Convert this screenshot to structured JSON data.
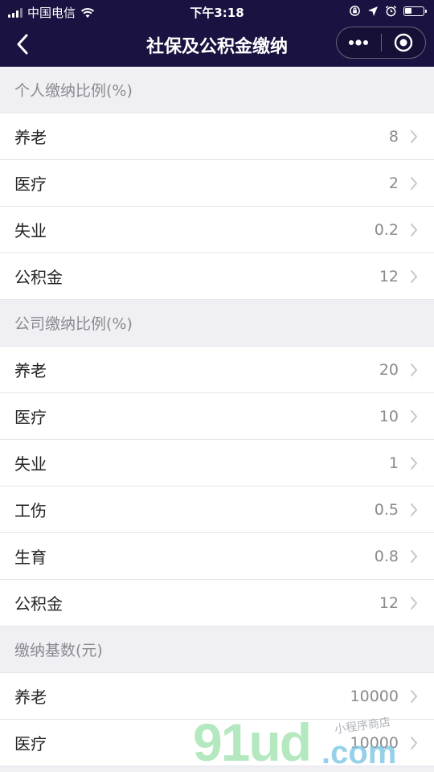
{
  "status_bar": {
    "carrier": "中国电信",
    "time": "下午3:18"
  },
  "nav": {
    "title": "社保及公积金缴纳",
    "back_icon": "chevron-left-icon",
    "more_icon": "more-dots-icon",
    "close_icon": "target-circle-icon"
  },
  "sections": [
    {
      "header": "个人缴纳比例(%)",
      "rows": [
        {
          "label": "养老",
          "value": "8"
        },
        {
          "label": "医疗",
          "value": "2"
        },
        {
          "label": "失业",
          "value": "0.2"
        },
        {
          "label": "公积金",
          "value": "12"
        }
      ]
    },
    {
      "header": "公司缴纳比例(%)",
      "rows": [
        {
          "label": "养老",
          "value": "20"
        },
        {
          "label": "医疗",
          "value": "10"
        },
        {
          "label": "失业",
          "value": "1"
        },
        {
          "label": "工伤",
          "value": "0.5"
        },
        {
          "label": "生育",
          "value": "0.8"
        },
        {
          "label": "公积金",
          "value": "12"
        }
      ]
    },
    {
      "header": "缴纳基数(元)",
      "rows": [
        {
          "label": "养老",
          "value": "10000"
        },
        {
          "label": "医疗",
          "value": "10000"
        }
      ]
    }
  ],
  "watermark": {
    "main": "91ud",
    "dot": ".com",
    "sub": "小程序商店"
  },
  "colors": {
    "nav_bg": "#1a1240",
    "page_bg": "#efeff4",
    "row_bg": "#ffffff",
    "muted_text": "#8a8a8f"
  }
}
